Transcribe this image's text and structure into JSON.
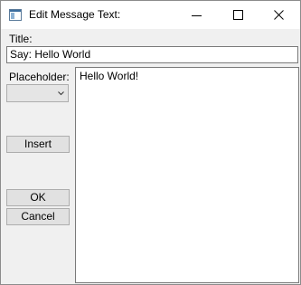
{
  "window": {
    "title": "Edit Message Text:",
    "icons": {
      "app": "window-app-icon",
      "minimize": "minimize-icon",
      "maximize": "maximize-icon",
      "close": "close-icon"
    }
  },
  "form": {
    "title_label": "Title:",
    "title_value": "Say: Hello World",
    "placeholder_label": "Placeholder:",
    "placeholder_value": "",
    "insert_label": "Insert",
    "ok_label": "OK",
    "cancel_label": "Cancel",
    "message_text": "Hello World!"
  },
  "colors": {
    "window_background": "#f0f0f0",
    "button_face": "#e1e1e1",
    "border": "#7a7a7a"
  }
}
